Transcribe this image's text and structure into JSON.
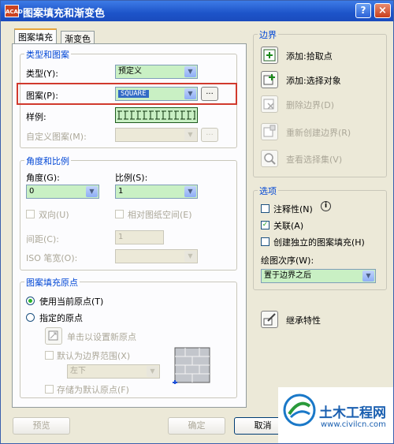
{
  "window": {
    "title": "图案填充和渐变色",
    "app_icon": "ACAD"
  },
  "titlebar": {
    "help_glyph": "?",
    "close_glyph": "×"
  },
  "tabs": [
    {
      "label": "图案填充",
      "active": true
    },
    {
      "label": "渐变色",
      "active": false
    }
  ],
  "type_pattern": {
    "group_title": "类型和图案",
    "type_label": "类型(Y):",
    "type_value": "预定义",
    "pattern_label": "图案(P):",
    "pattern_value": "SQUARE",
    "swatch_label": "样例:",
    "custom_label": "自定义图案(M):",
    "ellipsis": "..."
  },
  "angle_scale": {
    "group_title": "角度和比例",
    "angle_label": "角度(G):",
    "angle_value": "0",
    "scale_label": "比例(S):",
    "scale_value": "1",
    "double_label": "双向(U)",
    "relative_label": "相对图纸空间(E)",
    "spacing_label": "间距(C):",
    "spacing_value": "1",
    "iso_label": "ISO 笔宽(O):"
  },
  "origin": {
    "group_title": "图案填充原点",
    "current_label": "使用当前原点(T)",
    "specified_label": "指定的原点",
    "click_label": "单击以设置新原点",
    "default_extent_label": "默认为边界范围(X)",
    "position_value": "左下",
    "store_label": "存储为默认原点(F)"
  },
  "boundaries": {
    "group_title": "边界",
    "pick_points": "添加:拾取点",
    "select_objects": "添加:选择对象",
    "remove": "删除边界(D)",
    "recreate": "重新创建边界(R)",
    "view": "查看选择集(V)"
  },
  "options": {
    "group_title": "选项",
    "annotative_label": "注释性(N)",
    "info_glyph": "i",
    "associative_label": "关联(A)",
    "separate_label": "创建独立的图案填充(H)",
    "draw_order_label": "绘图次序(W):",
    "draw_order_value": "置于边界之后"
  },
  "inherit_label": "继承特性",
  "footer": {
    "preview": "预览",
    "ok": "确定",
    "cancel": "取消"
  },
  "watermark": {
    "name": "土木工程网",
    "url": "www.civilcn.com"
  },
  "icons": {
    "check": "✓",
    "arrow": "▼"
  }
}
